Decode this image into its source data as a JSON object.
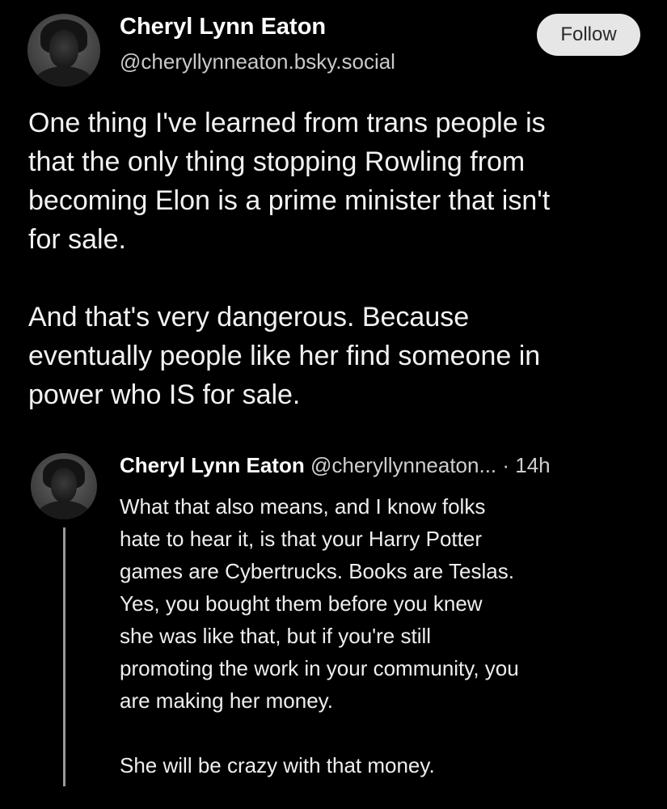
{
  "post": {
    "author_name": "Cheryl Lynn Eaton",
    "author_handle": "@cheryllynneaton.bsky.social",
    "follow_label": "Follow",
    "paragraph_1": "One thing I've learned from trans people is\nthat the only thing stopping Rowling from\nbecoming Elon is a prime minister that isn't\nfor sale.",
    "paragraph_2": "And that's very dangerous. Because\neventually people like her find someone in\npower who IS for sale."
  },
  "reply": {
    "author_name": "Cheryl Lynn Eaton",
    "author_handle": "@cheryllynneaton...",
    "separator": " · ",
    "time": "14h",
    "paragraph_1": "What that also means, and I know folks\nhate to hear it, is that your Harry Potter\ngames are Cybertrucks. Books are Teslas.\nYes, you bought them before you knew\nshe was like that, but if you're still\npromoting the work in your community, you\nare making her money.",
    "paragraph_2": "She will be crazy with that money."
  }
}
